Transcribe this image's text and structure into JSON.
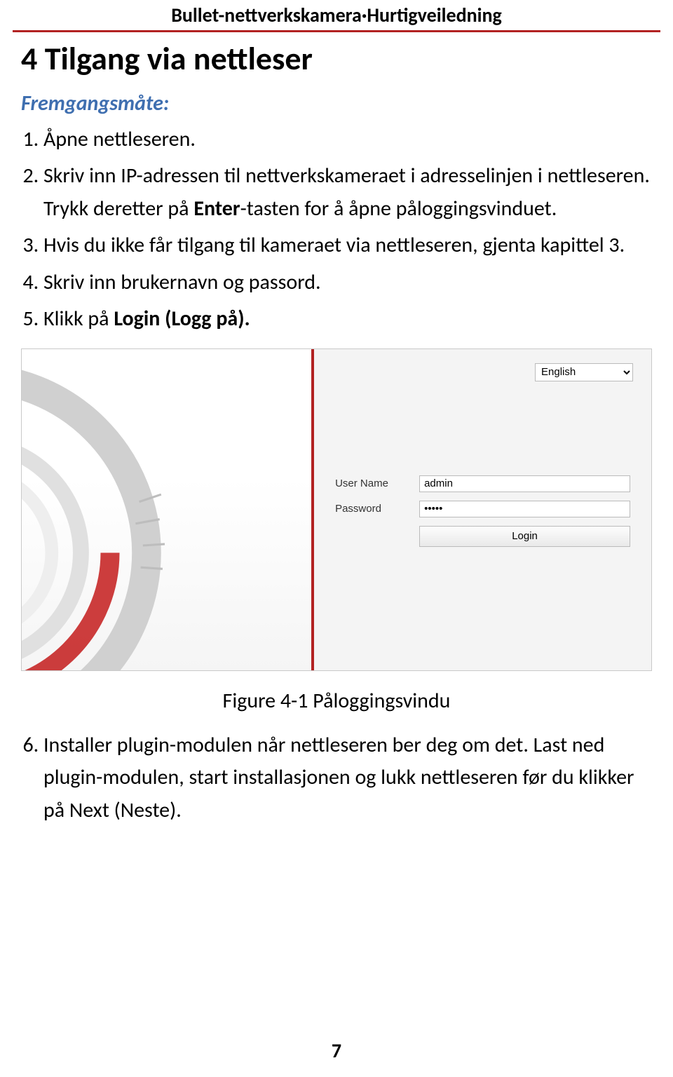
{
  "running_head": "Bullet-nettverkskamera·Hurtigveiledning",
  "section_title": "4 Tilgang via nettleser",
  "method_label": "Fremgangsmåte:",
  "steps": {
    "s1": "Åpne nettleseren.",
    "s2a": "Skriv inn IP-adressen til nettverkskameraet i adresselinjen i nettleseren. Trykk deretter på ",
    "s2b_bold": "Enter",
    "s2c": "-tasten for å åpne påloggingsvinduet.",
    "s3": "Hvis du ikke får tilgang til kameraet via nettleseren, gjenta kapittel 3.",
    "s4": "Skriv inn brukernavn og passord.",
    "s5a": "Klikk på ",
    "s5b_bold": "Login (Logg på).",
    "s6": "Installer plugin-modulen når nettleseren ber deg om det. Last ned plugin-modulen, start installasjonen og lukk nettleseren før du klikker på Next (Neste)."
  },
  "login_ui": {
    "language_option": "English",
    "username_label": "User Name",
    "username_value": "admin",
    "password_label": "Password",
    "password_value": "•••••",
    "login_button": "Login"
  },
  "figure_caption": "Figure 4-1 Påloggingsvindu",
  "page_number": "7"
}
